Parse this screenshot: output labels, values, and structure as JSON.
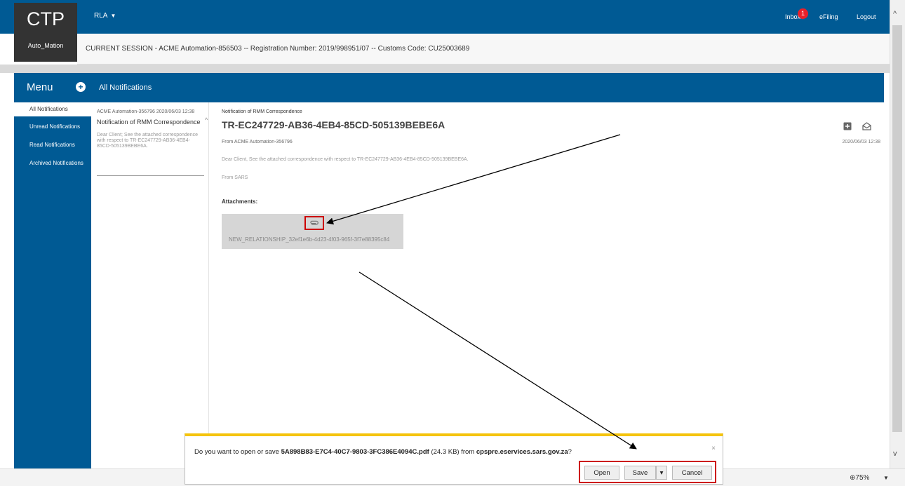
{
  "header": {
    "logo": "CTP",
    "user": "Auto_Mation",
    "menu_dropdown": "RLA",
    "inbox": "Inbox",
    "inbox_count": "1",
    "efiling": "eFiling",
    "logout": "Logout"
  },
  "session": {
    "text": "CURRENT SESSION - ACME Automation-856503 -- Registration Number: 2019/998951/07 -- Customs Code: CU25003689"
  },
  "menu": {
    "title": "Menu",
    "header_title": "All Notifications",
    "items": [
      {
        "label": "All Notifications"
      },
      {
        "label": "Unread Notifications"
      },
      {
        "label": "Read Notifications"
      },
      {
        "label": "Archived Notifications"
      }
    ]
  },
  "list": {
    "items": [
      {
        "meta": "ACME Automation-356796 2020/06/03 12:38",
        "title": "Notification of RMM Correspondence",
        "body": "Dear Client; See the attached correspondence with respect to TR-EC247729-AB36-4EB4-85CD-505139BEBE6A."
      }
    ]
  },
  "detail": {
    "kicker": "Notification of RMM Correspondence",
    "title": "TR-EC247729-AB36-4EB4-85CD-505139BEBE6A",
    "from": "From ACME Automation-356796",
    "date": "2020/06/03 12:38",
    "message": "Dear Client, See the attached correspondence with respect to TR-EC247729-AB36-4EB4-85CD-505139BEBE6A.",
    "signature": "From SARS",
    "attachments_label": "Attachments:",
    "attachment_name": "NEW_RELATIONSHIP_32ef1e6b-4d23-4f03-965f-3f7e88395c84"
  },
  "download_bar": {
    "prefix": "Do you want to open or save ",
    "filename": "5A898B83-E7C4-40C7-9803-3FC386E4094C.pdf",
    "size": " (24.3 KB) from ",
    "host": "cpspre.eservices.sars.gov.za",
    "suffix": "?",
    "open": "Open",
    "save": "Save",
    "cancel": "Cancel",
    "close": "×"
  },
  "status": {
    "zoom": "75%"
  },
  "colors": {
    "brand": "#005a94",
    "highlight": "#cc0000",
    "notification": "#f5c40d"
  }
}
